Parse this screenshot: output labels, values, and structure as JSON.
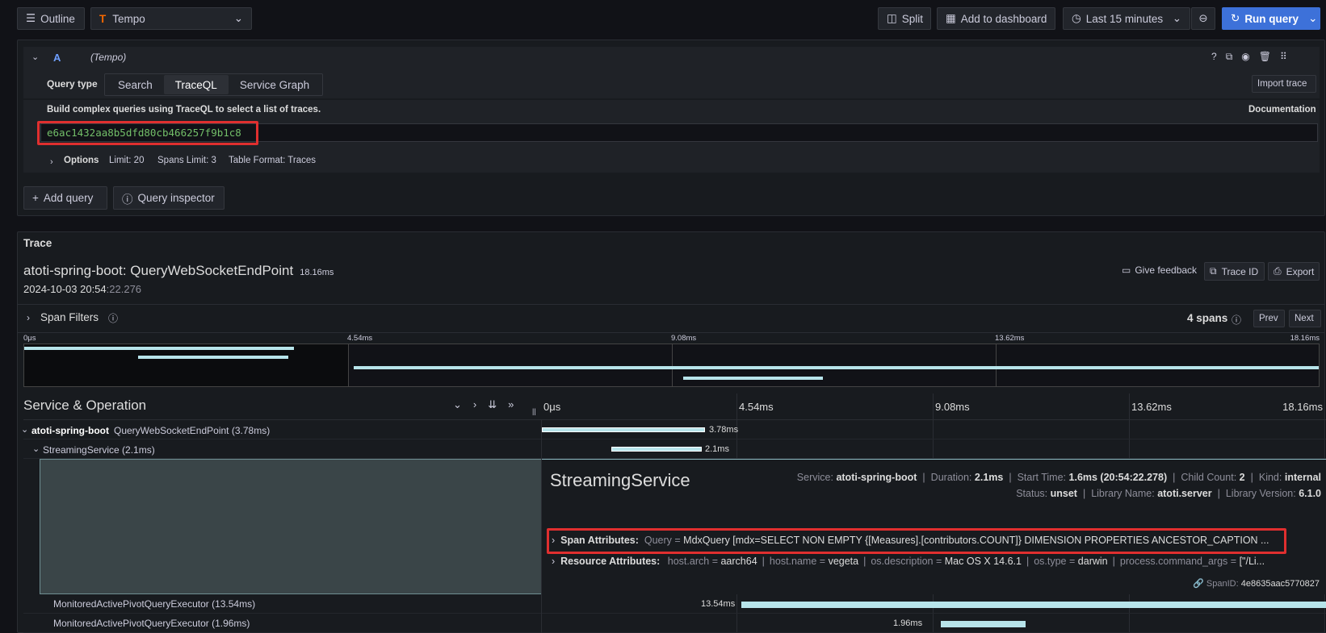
{
  "toolbar": {
    "outline_label": "Outline",
    "datasource": "Tempo",
    "split_label": "Split",
    "add_dashboard_label": "Add to dashboard",
    "time_range": "Last 15 minutes",
    "run_query_label": "Run query"
  },
  "query_editor": {
    "ref_id": "A",
    "datasource_tag": "(Tempo)",
    "query_type_label": "Query type",
    "query_types": [
      "Search",
      "TraceQL",
      "Service Graph"
    ],
    "active_query_type": "TraceQL",
    "import_trace_label": "Import trace",
    "hint": "Build complex queries using TraceQL to select a list of traces.",
    "documentation_label": "Documentation",
    "query_value": "e6ac1432aa8b5dfd80cb466257f9b1c8",
    "options_label": "Options",
    "options_summary": [
      "Limit: 20",
      "Spans Limit: 3",
      "Table Format: Traces"
    ]
  },
  "actions": {
    "add_query_label": "Add query",
    "query_inspector_label": "Query inspector"
  },
  "trace": {
    "panel_title": "Trace",
    "service": "atoti-spring-boot: QueryWebSocketEndPoint",
    "duration": "18.16ms",
    "timestamp_main": "2024-10-03 20:54",
    "timestamp_rest": ":22.276",
    "feedback_label": "Give feedback",
    "trace_id_label": "Trace ID",
    "export_label": "Export",
    "span_filters_label": "Span Filters",
    "spans_count": "4 spans",
    "prev_label": "Prev",
    "next_label": "Next",
    "minimap_ticks": [
      "0μs",
      "4.54ms",
      "9.08ms",
      "13.62ms",
      "18.16ms"
    ],
    "header_title": "Service & Operation",
    "timeline_ticks": [
      "0μs",
      "4.54ms",
      "9.08ms",
      "13.62ms",
      "18.16ms"
    ]
  },
  "spans": [
    {
      "service": "atoti-spring-boot",
      "operation": "QueryWebSocketEndPoint (3.78ms)",
      "label": "3.78ms",
      "start_ms": 0,
      "duration_ms": 3.78
    },
    {
      "service": "",
      "operation": "StreamingService (2.1ms)",
      "label": "2.1ms",
      "start_ms": 1.6,
      "duration_ms": 2.1
    },
    {
      "service": "",
      "operation": "MonitoredActivePivotQueryExecutor (13.54ms)",
      "label": "13.54ms",
      "start_ms": 4.62,
      "duration_ms": 13.54
    },
    {
      "service": "",
      "operation": "MonitoredActivePivotQueryExecutor (1.96ms)",
      "label": "1.96ms",
      "start_ms": 9.24,
      "duration_ms": 1.96
    }
  ],
  "detail": {
    "title": "StreamingService",
    "service_label": "Service:",
    "service_value": "atoti-spring-boot",
    "duration_label": "Duration:",
    "duration_value": "2.1ms",
    "start_label": "Start Time:",
    "start_value": "1.6ms (20:54:22.278)",
    "child_label": "Child Count:",
    "child_value": "2",
    "kind_label": "Kind:",
    "kind_value": "internal",
    "status_label": "Status:",
    "status_value": "unset",
    "lib_name_label": "Library Name:",
    "lib_name_value": "atoti.server",
    "lib_version_label": "Library Version:",
    "lib_version_value": "6.1.0",
    "span_attr_label": "Span Attributes:",
    "span_attr_key": "Query",
    "span_attr_eq": "=",
    "span_attr_value": "MdxQuery [mdx=SELECT NON EMPTY {[Measures].[contributors.COUNT]} DIMENSION PROPERTIES ANCESTOR_CAPTION ...",
    "res_attr_label": "Resource Attributes:",
    "res_attrs": [
      {
        "k": "host.arch",
        "v": "aarch64"
      },
      {
        "k": "host.name",
        "v": "vegeta"
      },
      {
        "k": "os.description",
        "v": "Mac OS X 14.6.1"
      },
      {
        "k": "os.type",
        "v": "darwin"
      },
      {
        "k": "process.command_args",
        "v": "[\"/Li..."
      }
    ],
    "span_id_label": "SpanID:",
    "span_id_value": "4e8635aac5770827"
  },
  "colors": {
    "accent": "#3d71d9",
    "bar": "#b7e4ea",
    "highlight": "#e02f2f",
    "query_green": "#73bf69"
  }
}
